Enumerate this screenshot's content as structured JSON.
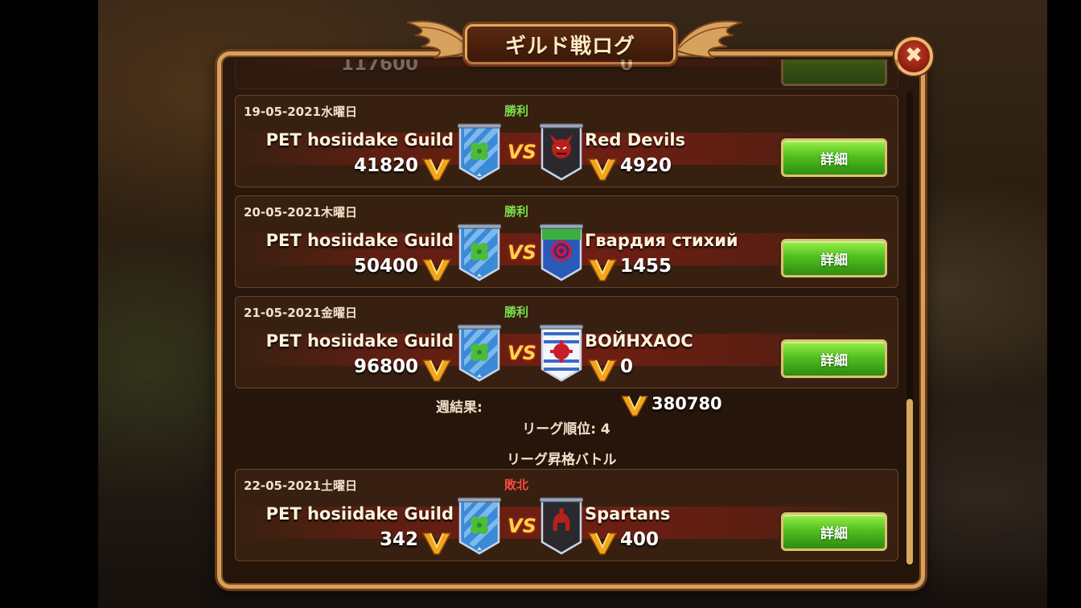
{
  "title": "ギルド戦ログ",
  "close_icon": "close-icon",
  "detail_label": "詳細",
  "vs_label": "VS",
  "faded_top": {
    "score_left": "117600",
    "score_right": "0"
  },
  "battles": [
    {
      "date": "19-05-2021水曜日",
      "result": "勝利",
      "result_type": "win",
      "left_guild": "PET hosiidake Guild",
      "left_score": "41820",
      "right_guild": "Red Devils",
      "right_score": "4920",
      "right_emblem": "demon-mask-icon"
    },
    {
      "date": "20-05-2021木曜日",
      "result": "勝利",
      "result_type": "win",
      "left_guild": "PET hosiidake Guild",
      "left_score": "50400",
      "right_guild": "Гвардия стихий",
      "right_score": "1455",
      "right_emblem": "sun-emblem-icon"
    },
    {
      "date": "21-05-2021金曜日",
      "result": "勝利",
      "result_type": "win",
      "left_guild": "PET hosiidake Guild",
      "left_score": "96800",
      "right_guild": "ВОЙНХАОС",
      "right_score": "0",
      "right_emblem": "cross-emblem-icon"
    }
  ],
  "summary": {
    "weekly_label": "週結果:",
    "weekly_value": "380780",
    "league_rank": "リーグ順位: 4"
  },
  "promotion": {
    "heading": "リーグ昇格バトル",
    "battle": {
      "date": "22-05-2021土曜日",
      "result": "敗北",
      "result_type": "loss",
      "left_guild": "PET hosiidake Guild",
      "left_score": "342",
      "right_guild": "Spartans",
      "right_score": "400",
      "right_emblem": "spartan-helmet-icon"
    }
  },
  "colors": {
    "win": "#7be04a",
    "loss": "#ff4a3a",
    "frame_gold": "#d9a05a",
    "button_green": "#52c020"
  }
}
